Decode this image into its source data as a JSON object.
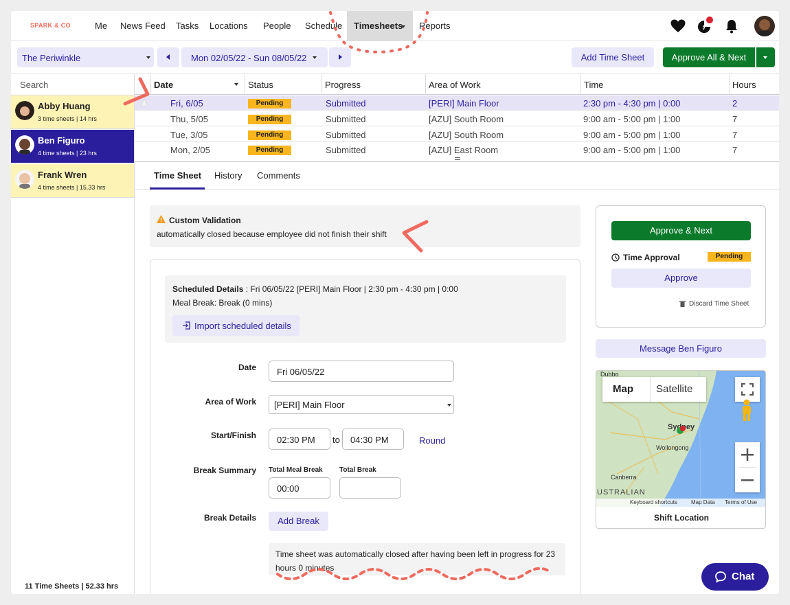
{
  "nav": {
    "logo": "SPARK & CO",
    "items": [
      "Me",
      "News Feed",
      "Tasks",
      "Locations",
      "People",
      "Schedule"
    ],
    "active": "Timesheets",
    "after_active": "Reports",
    "icons": [
      "heart-icon",
      "pie-chart-icon",
      "bell-icon",
      "user-avatar"
    ]
  },
  "toolbar": {
    "location": "The Periwinkle",
    "date_range": "Mon 02/05/22 - Sun 08/05/22",
    "add_label": "Add Time Sheet",
    "approve_all_label": "Approve All & Next"
  },
  "sidebar": {
    "search_placeholder": "Search",
    "employees": [
      {
        "name": "Abby Huang",
        "sub": "3 time sheets | 14 hrs"
      },
      {
        "name": "Ben Figuro",
        "sub": "4 time sheets | 23 hrs"
      },
      {
        "name": "Frank Wren",
        "sub": "4 time sheets | 15.33 hrs"
      }
    ],
    "footer": "11 Time Sheets | 52.33 hrs"
  },
  "grid": {
    "headers": [
      "Date",
      "Status",
      "Progress",
      "Area of Work",
      "Time",
      "Hours"
    ],
    "rows": [
      {
        "date": "Fri, 6/05",
        "status": "Pending",
        "progress": "Submitted",
        "area": "[PERI] Main Floor",
        "time": "2:30 pm - 4:30 pm | 0:00",
        "hours": "2"
      },
      {
        "date": "Thu, 5/05",
        "status": "Pending",
        "progress": "Submitted",
        "area": "[AZU] South Room",
        "time": "9:00 am - 5:00 pm | 1:00",
        "hours": "7"
      },
      {
        "date": "Tue, 3/05",
        "status": "Pending",
        "progress": "Submitted",
        "area": "[AZU] South Room",
        "time": "9:00 am - 5:00 pm | 1:00",
        "hours": "7"
      },
      {
        "date": "Mon, 2/05",
        "status": "Pending",
        "progress": "Submitted",
        "area": "[AZU] East Room",
        "time": "9:00 am - 5:00 pm | 1:00",
        "hours": "7"
      }
    ]
  },
  "tabs": [
    "Time Sheet",
    "History",
    "Comments"
  ],
  "alert": {
    "title": "Custom Validation",
    "message": "automatically closed because employee did not finish their shift"
  },
  "sched": {
    "label": "Scheduled Details",
    "value": " : Fri 06/05/22 [PERI] Main Floor | 2:30 pm - 4:30 pm | 0:00",
    "meal": "Meal Break: Break (0 mins)",
    "import_label": "Import scheduled details"
  },
  "form": {
    "date_label": "Date",
    "date_value": "Fri 06/05/22",
    "area_label": "Area of Work",
    "area_value": "[PERI] Main Floor",
    "sf_label": "Start/Finish",
    "start": "02:30 PM",
    "to": "to",
    "finish": "04:30 PM",
    "round": "Round",
    "bs_label": "Break Summary",
    "meal_label": "Total Meal Break",
    "meal_value": "00:00",
    "total_label": "Total Break",
    "total_value": "",
    "bd_label": "Break Details",
    "add_break": "Add Break",
    "note": "Time sheet was automatically closed after having been left in progress for 23 hours 0 minutes"
  },
  "approval": {
    "approve_next": "Approve & Next",
    "time_approval": "Time Approval",
    "status": "Pending",
    "approve": "Approve",
    "discard": "Discard Time Sheet",
    "message": "Message Ben Figuro"
  },
  "map": {
    "tab_map": "Map",
    "tab_sat": "Satellite",
    "cities": [
      "Dubbo",
      "Sydney",
      "Wollongong",
      "Canberra",
      "USTRALIAN"
    ],
    "footer": [
      "Keyboard shortcuts",
      "Map Data",
      "Terms of Use"
    ],
    "caption": "Shift Location"
  },
  "chat_label": "Chat",
  "colors": {
    "accent": "#2a1e9c",
    "green": "#0b7a2a",
    "pending": "#f8b51e",
    "highlight": "#fdf3b4"
  }
}
